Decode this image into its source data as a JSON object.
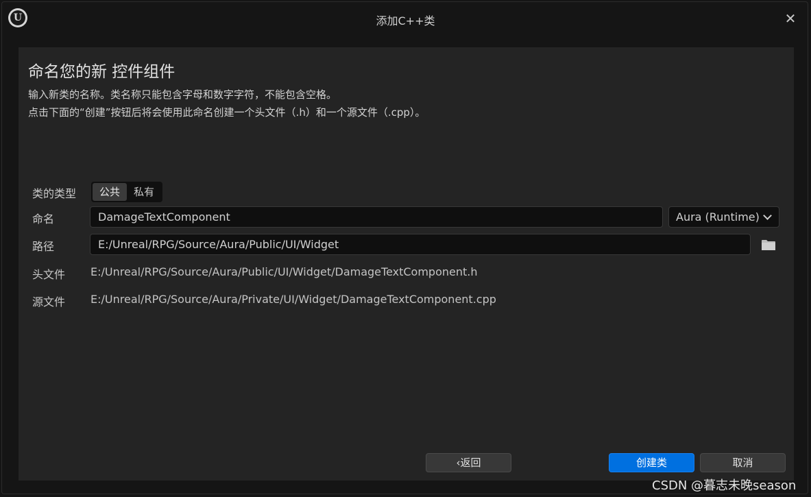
{
  "window": {
    "title": "添加C++类",
    "close_glyph": "✕",
    "logo_glyph": "U"
  },
  "panel": {
    "heading": "命名您的新 控件组件",
    "description_line1": "输入新类的名称。类名称只能包含字母和数字字符，不能包含空格。",
    "description_line2": "点击下面的“创建”按钮后将会使用此命名创建一个头文件（.h）和一个源文件（.cpp）。"
  },
  "form": {
    "class_type": {
      "label": "类的类型",
      "options": [
        "公共",
        "私有"
      ],
      "selected": "公共"
    },
    "name": {
      "label": "命名",
      "value": "DamageTextComponent"
    },
    "module": {
      "value": "Aura (Runtime)"
    },
    "path": {
      "label": "路径",
      "value": "E:/Unreal/RPG/Source/Aura/Public/UI/Widget"
    },
    "header_file": {
      "label": "头文件",
      "value": "E:/Unreal/RPG/Source/Aura/Public/UI/Widget/DamageTextComponent.h"
    },
    "source_file": {
      "label": "源文件",
      "value": "E:/Unreal/RPG/Source/Aura/Private/UI/Widget/DamageTextComponent.cpp"
    }
  },
  "buttons": {
    "back": "‹返回",
    "create": "创建类",
    "cancel": "取消"
  },
  "watermark": "CSDN @暮志未晚season",
  "icons": {
    "folder": "folder-icon",
    "chevron": "chevron-down-icon"
  },
  "colors": {
    "primary_button": "#0070e0",
    "background": "#151515",
    "panel": "#242424"
  }
}
